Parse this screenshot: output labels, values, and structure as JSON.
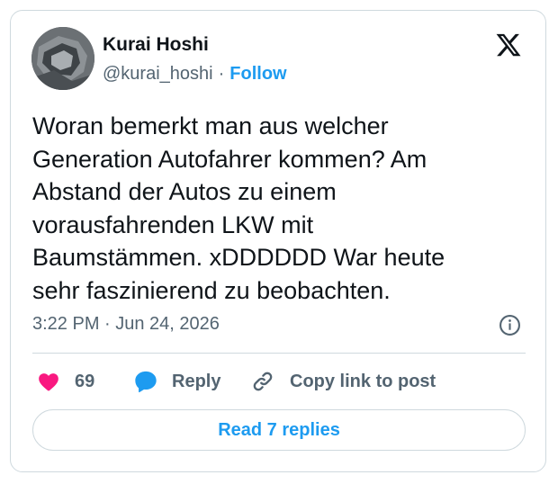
{
  "author": {
    "display_name": "Kurai Hoshi",
    "handle": "@kurai_hoshi",
    "separator": "·",
    "follow_label": "Follow"
  },
  "tweet": {
    "text": "Woran bemerkt man aus welcher\nGeneration Autofahrer kommen? Am\nAbstand der Autos zu einem\nvorausfahrenden LKW mit\nBaumstämmen. xDDDDDD War heute\nsehr faszinierend zu beobachten.",
    "timestamp": "3:22 PM · Jun 24, 2026"
  },
  "actions": {
    "like_count": "69",
    "reply_label": "Reply",
    "copy_label": "Copy link to post"
  },
  "read_replies_label": "Read 7 replies",
  "icons": {
    "brand": "x-logo-icon",
    "info": "info-icon",
    "like": "heart-icon",
    "reply": "speech-bubble-icon",
    "copy": "link-icon"
  },
  "colors": {
    "accent": "#1d9bf0",
    "like": "#f91880",
    "muted": "#536471",
    "text": "#0f1419",
    "border": "#cfd9de"
  }
}
